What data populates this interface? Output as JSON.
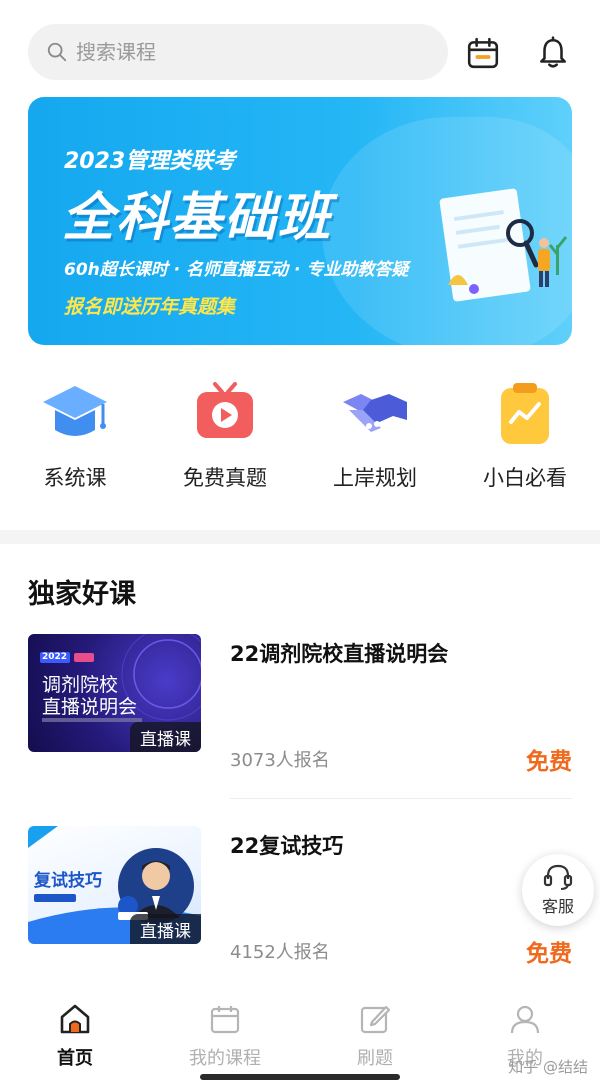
{
  "search": {
    "placeholder": "搜索课程"
  },
  "header_icons": [
    "calendar-icon",
    "bell-icon"
  ],
  "banner": {
    "year_line": "2023管理类联考",
    "title": "全科基础班",
    "subtitle": "60h超长课时 · 名师直播互动 · 专业助教答疑",
    "promo": "报名即送历年真题集"
  },
  "quick_menu": [
    {
      "label": "系统课",
      "icon": "graduation-cap-icon"
    },
    {
      "label": "免费真题",
      "icon": "tv-play-icon"
    },
    {
      "label": "上岸规划",
      "icon": "handshake-icon"
    },
    {
      "label": "小白必看",
      "icon": "clipboard-chart-icon"
    }
  ],
  "section": {
    "title": "独家好课"
  },
  "courses": [
    {
      "title": "22调剂院校直播说明会",
      "enrolled": "3073人报名",
      "price": "免费",
      "tag": "直播课",
      "thumb_year": "2022",
      "thumb_line1": "调剂院校",
      "thumb_line2": "直播说明会"
    },
    {
      "title": "22复试技巧",
      "enrolled": "4152人报名",
      "price": "免费",
      "tag": "直播课",
      "thumb_line1": "复试技巧"
    }
  ],
  "service": {
    "label": "客服"
  },
  "bottom_nav": [
    {
      "label": "首页",
      "icon": "home-icon",
      "active": true
    },
    {
      "label": "我的课程",
      "icon": "course-calendar-icon",
      "active": false
    },
    {
      "label": "刷题",
      "icon": "edit-icon",
      "active": false
    },
    {
      "label": "我的",
      "icon": "user-icon",
      "active": false
    }
  ],
  "watermark": "知乎 @结结",
  "colors": {
    "accent": "#f06a1e",
    "banner": "#1fb0f2",
    "calendar": "#f5a020"
  }
}
